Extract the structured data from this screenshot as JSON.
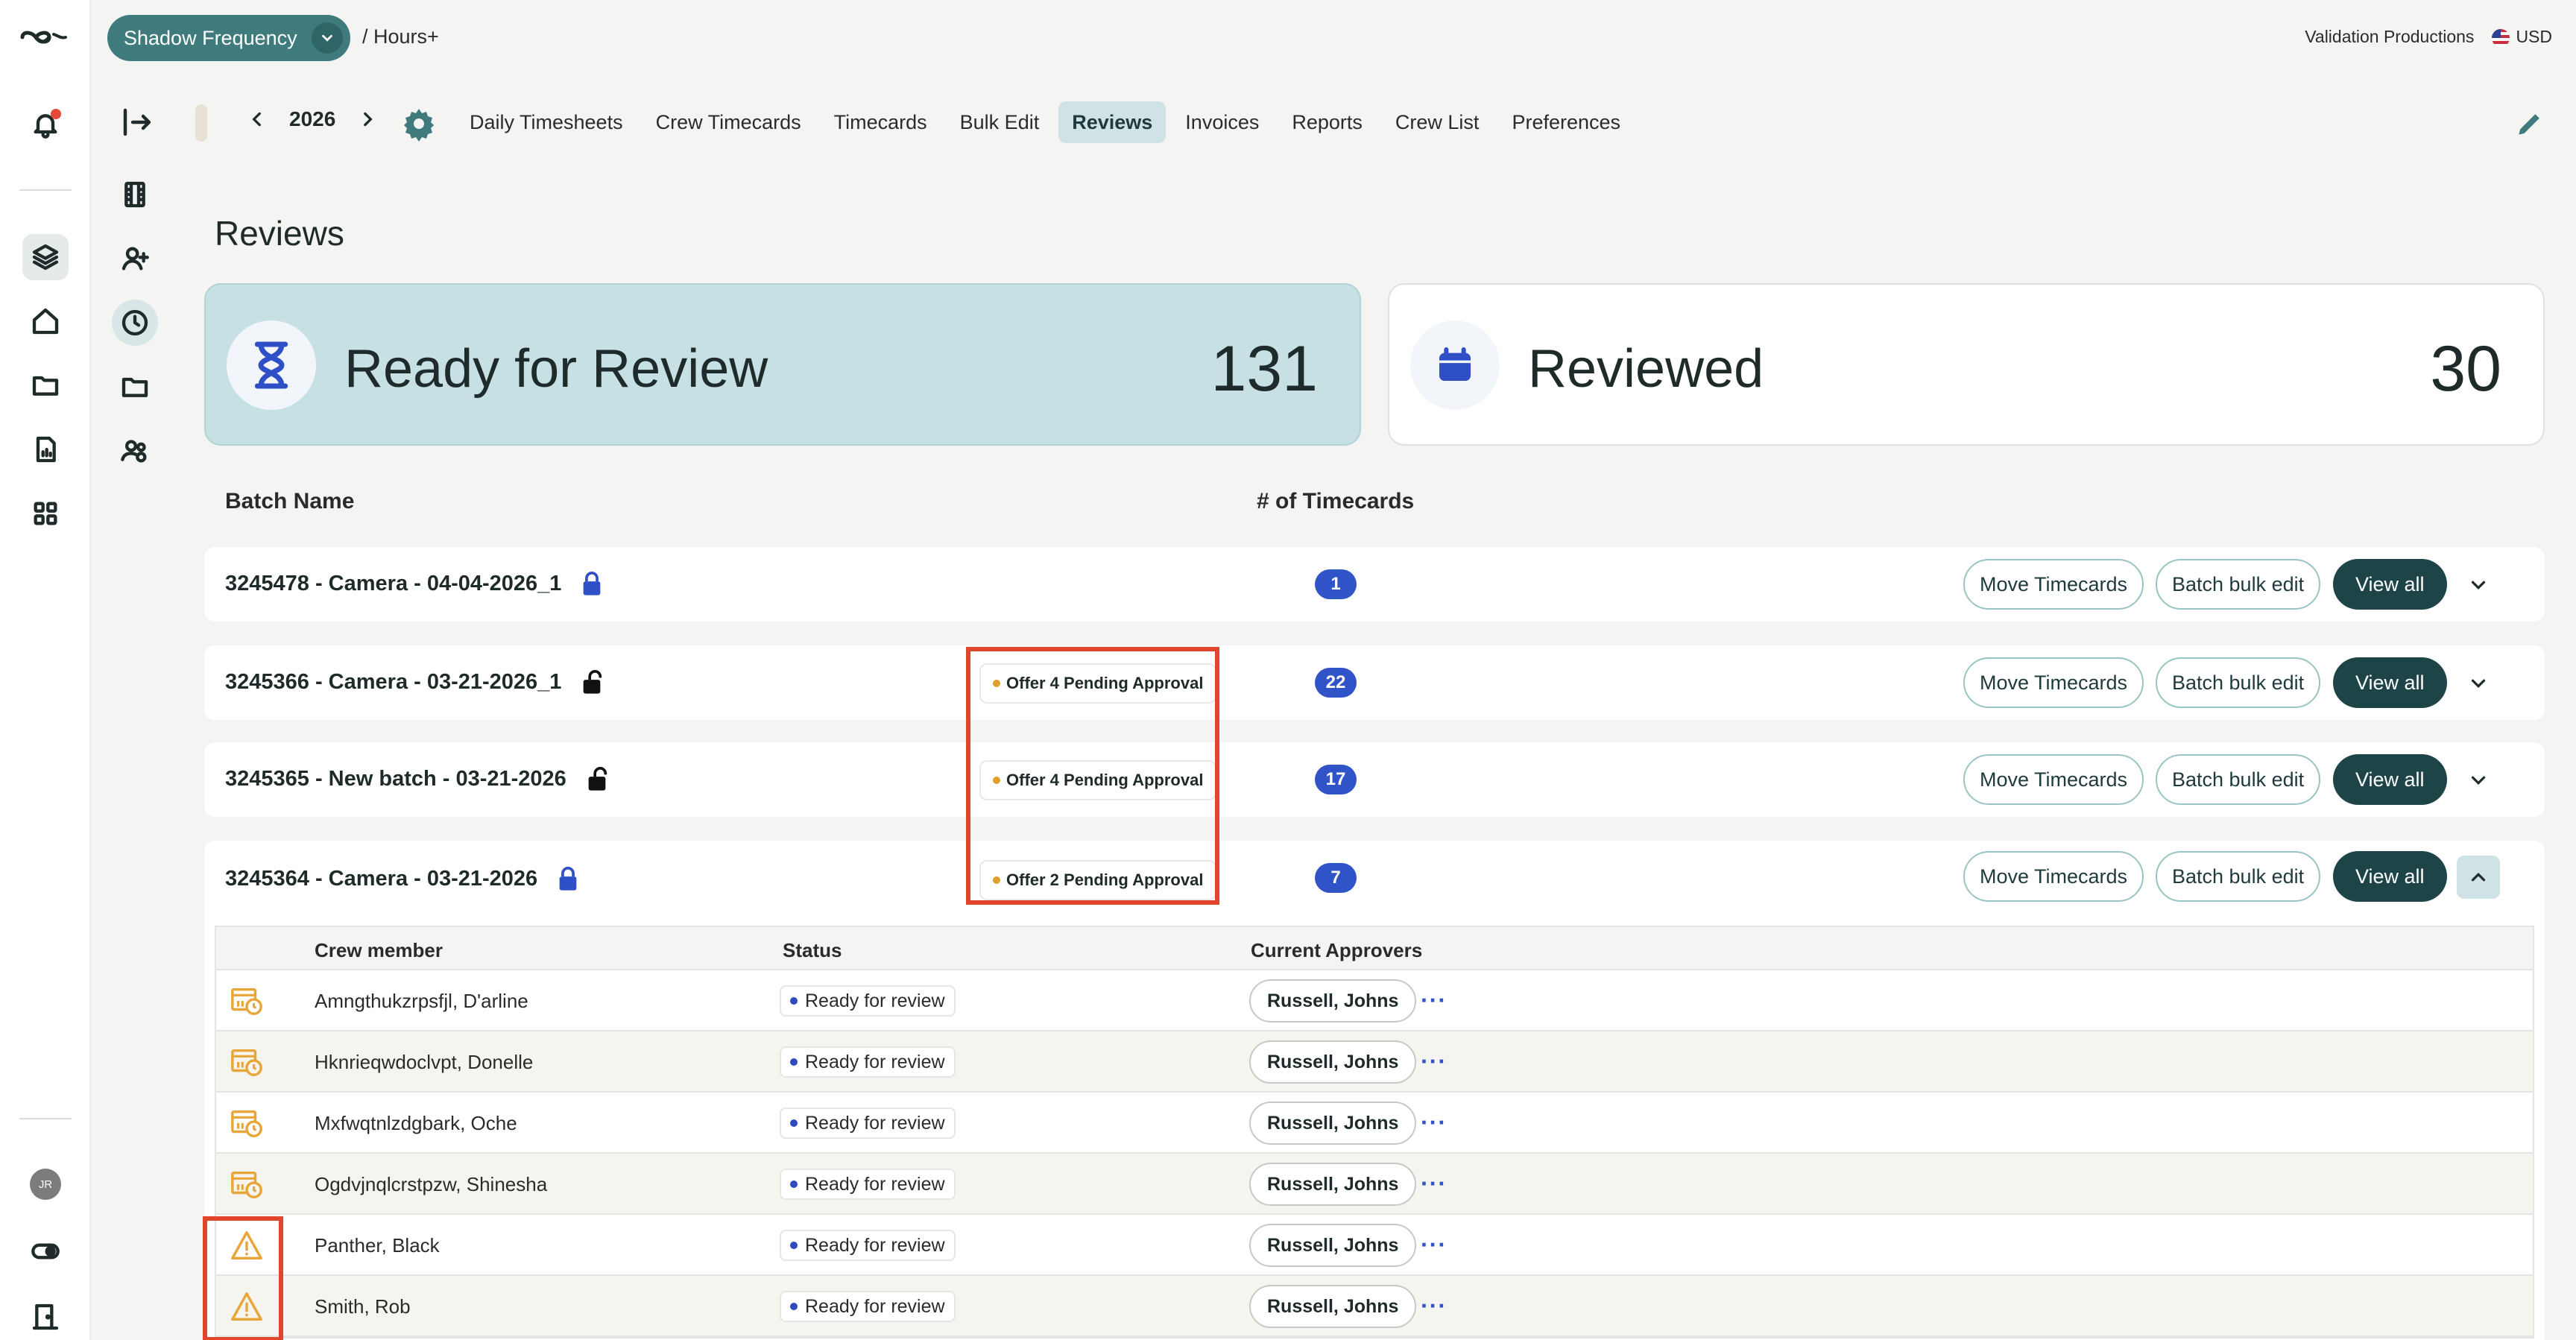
{
  "header": {
    "project_name": "Shadow Frequency",
    "breadcrumb": "/ Hours+",
    "company": "Validation Productions",
    "currency": "USD"
  },
  "nav": {
    "year": "2026",
    "tabs": [
      {
        "label": "Daily Timesheets"
      },
      {
        "label": "Crew Timecards"
      },
      {
        "label": "Timecards"
      },
      {
        "label": "Bulk Edit"
      },
      {
        "label": "Reviews"
      },
      {
        "label": "Invoices"
      },
      {
        "label": "Reports"
      },
      {
        "label": "Crew List"
      },
      {
        "label": "Preferences"
      }
    ],
    "active_tab": "Reviews"
  },
  "page": {
    "title": "Reviews",
    "summary": {
      "ready": {
        "label": "Ready for Review",
        "count": "131"
      },
      "reviewed": {
        "label": "Reviewed",
        "count": "30"
      }
    },
    "columns": {
      "batch_name": "Batch Name",
      "timecards": "# of Timecards"
    }
  },
  "actions": {
    "move": "Move Timecards",
    "bulk": "Batch bulk edit",
    "view": "View all"
  },
  "batches": [
    {
      "name": "3245478 - Camera - 04-04-2026_1",
      "locked": true,
      "count": "1",
      "pending": ""
    },
    {
      "name": "3245366 - Camera - 03-21-2026_1",
      "locked": false,
      "count": "22",
      "pending": "Offer 4 Pending Approval"
    },
    {
      "name": "3245365 - New batch - 03-21-2026",
      "locked": false,
      "count": "17",
      "pending": "Offer 4 Pending Approval"
    },
    {
      "name": "3245364 - Camera - 03-21-2026",
      "locked": true,
      "count": "7",
      "pending": "Offer 2 Pending Approval",
      "expanded": true
    }
  ],
  "table": {
    "headers": {
      "crew": "Crew member",
      "status": "Status",
      "approvers": "Current Approvers"
    },
    "rows": [
      {
        "icon": "timecard-clock-icon",
        "crew": "Amngthukzrpsfjl, D'arline",
        "status": "Ready for review",
        "approver": "Russell, Johns"
      },
      {
        "icon": "timecard-clock-icon",
        "crew": "Hknrieqwdoclvpt, Donelle",
        "status": "Ready for review",
        "approver": "Russell, Johns"
      },
      {
        "icon": "timecard-clock-icon",
        "crew": "Mxfwqtnlzdgbark, Oche",
        "status": "Ready for review",
        "approver": "Russell, Johns"
      },
      {
        "icon": "timecard-clock-icon",
        "crew": "Ogdvjnqlcrstpzw, Shinesha",
        "status": "Ready for review",
        "approver": "Russell, Johns"
      },
      {
        "icon": "warning-icon",
        "crew": "Panther, Black",
        "status": "Ready for review",
        "approver": "Russell, Johns"
      },
      {
        "icon": "warning-icon",
        "crew": "Smith, Rob",
        "status": "Ready for review",
        "approver": "Russell, Johns"
      }
    ]
  },
  "user": {
    "initials": "JR"
  },
  "colors": {
    "accent": "#3f7b7d",
    "dark_button": "#1d4447",
    "badge_blue": "#3153c8",
    "ready_card": "#c6e0e3",
    "pending_dot": "#e0a02b",
    "highlight_red": "#e2452e",
    "icon_orange": "#e8a53a"
  }
}
